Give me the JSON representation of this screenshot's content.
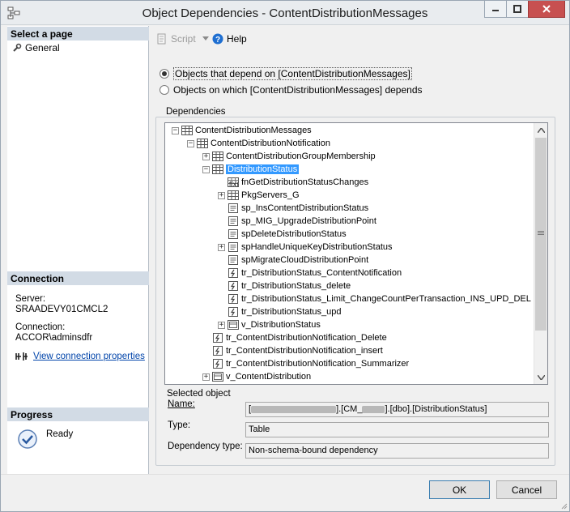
{
  "window": {
    "title": "Object Dependencies - ContentDistributionMessages"
  },
  "left_panel": {
    "select_page_header": "Select a page",
    "pages": [
      {
        "label": "General",
        "icon": "wrench-icon"
      }
    ],
    "connection_header": "Connection",
    "server_label": "Server:",
    "server_value": "SRAADEVY01CMCL2",
    "connection_label": "Connection:",
    "connection_value": "ACCOR\\adminsdfr",
    "view_connection_link": "View connection properties",
    "progress_header": "Progress",
    "progress_status": "Ready"
  },
  "toolbar": {
    "script_label": "Script",
    "help_label": "Help"
  },
  "options": {
    "depend_on": "Objects that depend on [ContentDistributionMessages]",
    "depends_which": "Objects on which [ContentDistributionMessages] depends",
    "selected": "depend_on"
  },
  "dependencies": {
    "group_title": "Dependencies",
    "tree": [
      {
        "label": "ContentDistributionMessages",
        "level": 0,
        "toggle": "-",
        "icon": "table-icon"
      },
      {
        "label": "ContentDistributionNotification",
        "level": 1,
        "toggle": "-",
        "icon": "table-icon"
      },
      {
        "label": "ContentDistributionGroupMembership",
        "level": 2,
        "toggle": "+",
        "icon": "table-icon"
      },
      {
        "label": "DistributionStatus",
        "level": 2,
        "toggle": "-",
        "icon": "table-icon",
        "selected": true
      },
      {
        "label": "fnGetDistributionStatusChanges",
        "level": 3,
        "toggle": "",
        "icon": "function-icon"
      },
      {
        "label": "PkgServers_G",
        "level": 3,
        "toggle": "+",
        "icon": "table-icon"
      },
      {
        "label": "sp_InsContentDistributionStatus",
        "level": 3,
        "toggle": "",
        "icon": "procedure-icon"
      },
      {
        "label": "sp_MIG_UpgradeDistributionPoint",
        "level": 3,
        "toggle": "",
        "icon": "procedure-icon"
      },
      {
        "label": "spDeleteDistributionStatus",
        "level": 3,
        "toggle": "",
        "icon": "procedure-icon"
      },
      {
        "label": "spHandleUniqueKeyDistributionStatus",
        "level": 3,
        "toggle": "+",
        "icon": "procedure-icon"
      },
      {
        "label": "spMigrateCloudDistributionPoint",
        "level": 3,
        "toggle": "",
        "icon": "procedure-icon"
      },
      {
        "label": "tr_DistributionStatus_ContentNotification",
        "level": 3,
        "toggle": "",
        "icon": "trigger-icon"
      },
      {
        "label": "tr_DistributionStatus_delete",
        "level": 3,
        "toggle": "",
        "icon": "trigger-icon"
      },
      {
        "label": "tr_DistributionStatus_Limit_ChangeCountPerTransaction_INS_UPD_DEL",
        "level": 3,
        "toggle": "",
        "icon": "trigger-icon"
      },
      {
        "label": "tr_DistributionStatus_upd",
        "level": 3,
        "toggle": "",
        "icon": "trigger-icon"
      },
      {
        "label": "v_DistributionStatus",
        "level": 3,
        "toggle": "+",
        "icon": "view-icon"
      },
      {
        "label": "tr_ContentDistributionNotification_Delete",
        "level": 2,
        "toggle": "",
        "icon": "trigger-icon"
      },
      {
        "label": "tr_ContentDistributionNotification_insert",
        "level": 2,
        "toggle": "",
        "icon": "trigger-icon"
      },
      {
        "label": "tr_ContentDistributionNotification_Summarizer",
        "level": 2,
        "toggle": "",
        "icon": "trigger-icon"
      },
      {
        "label": "v_ContentDistribution",
        "level": 2,
        "toggle": "+",
        "icon": "view-icon"
      }
    ]
  },
  "selected_object": {
    "header": "Selected object",
    "name_label": "Name:",
    "name_value_rest": "].[CM_",
    "name_value_tail": "].[dbo].[DistributionStatus]",
    "type_label": "Type:",
    "type_value": "Table",
    "dependency_type_label": "Dependency type:",
    "dependency_type_value": "Non-schema-bound dependency"
  },
  "buttons": {
    "ok": "OK",
    "cancel": "Cancel"
  }
}
